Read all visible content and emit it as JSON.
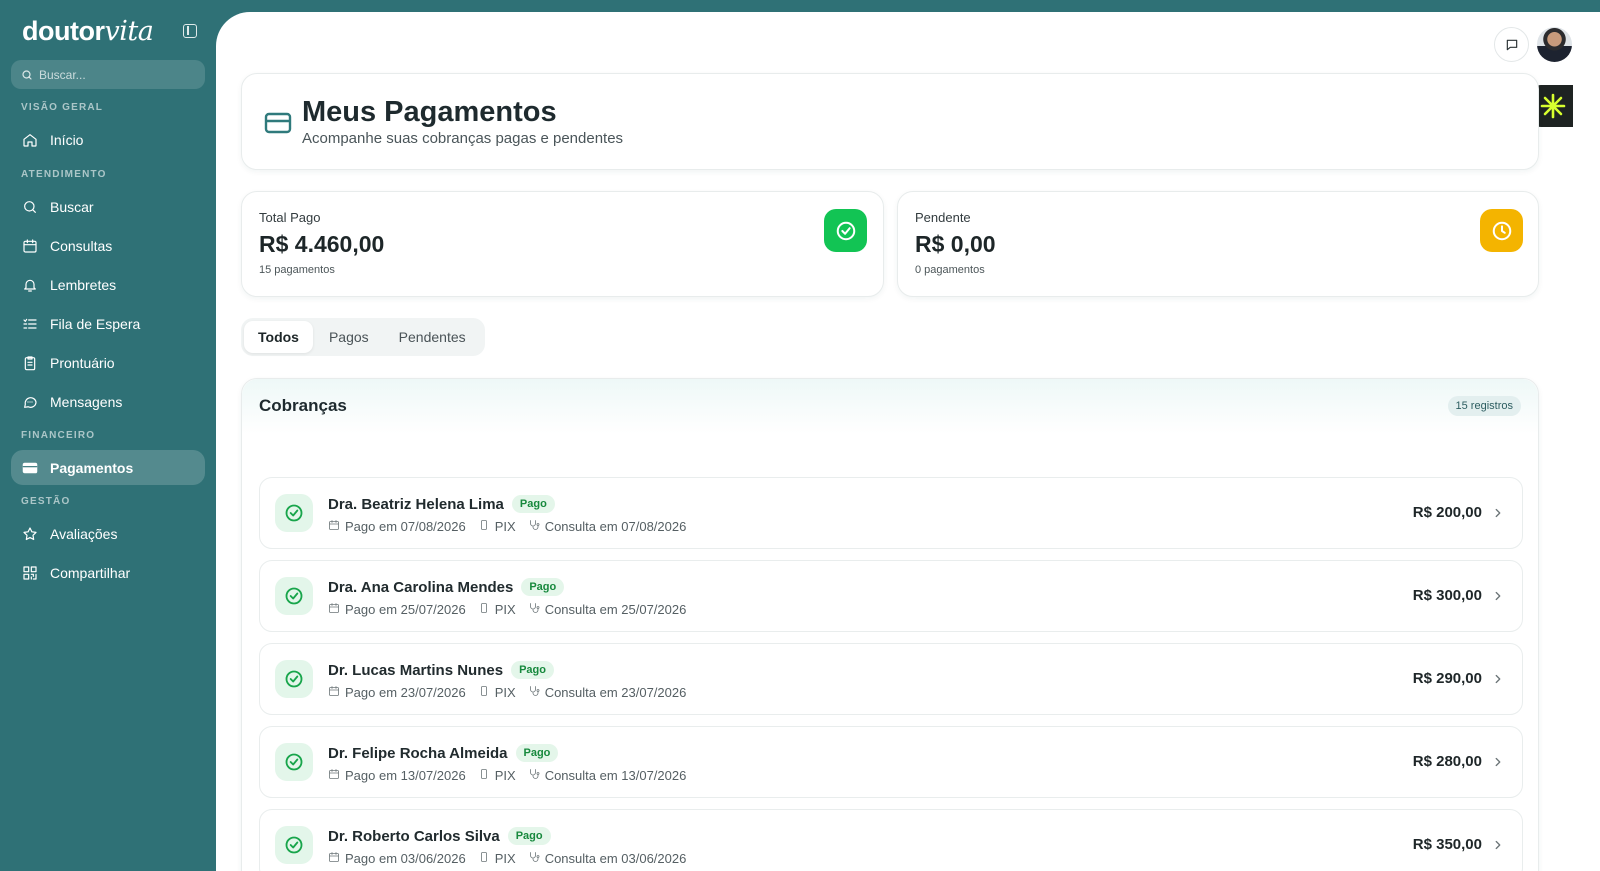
{
  "sidebar": {
    "logo_main": "doutor",
    "logo_accent": "vita",
    "search_placeholder": "Buscar...",
    "sections": {
      "overview": "VISÃO GERAL",
      "service": "ATENDIMENTO",
      "financial": "FINANCEIRO",
      "management": "GESTÃO"
    },
    "items": [
      {
        "label": "Início",
        "icon": "home-icon"
      },
      {
        "label": "Buscar",
        "icon": "search-icon"
      },
      {
        "label": "Consultas",
        "icon": "calendar-icon"
      },
      {
        "label": "Lembretes",
        "icon": "bell-icon"
      },
      {
        "label": "Fila de Espera",
        "icon": "list-check-icon"
      },
      {
        "label": "Prontuário",
        "icon": "clipboard-icon"
      },
      {
        "label": "Mensagens",
        "icon": "message-icon"
      },
      {
        "label": "Pagamentos",
        "icon": "credit-card-icon",
        "active": true
      },
      {
        "label": "Avaliações",
        "icon": "star-icon"
      },
      {
        "label": "Compartilhar",
        "icon": "qr-code-icon"
      }
    ]
  },
  "header": {
    "title": "Meus Pagamentos",
    "subtitle": "Acompanhe suas cobranças pagas e pendentes"
  },
  "stats": {
    "paid": {
      "label": "Total Pago",
      "value": "R$ 4.460,00",
      "count": "15 pagamentos",
      "color": "#12c454"
    },
    "pending": {
      "label": "Pendente",
      "value": "R$ 0,00",
      "count": "0 pagamentos",
      "color": "#f4b400"
    }
  },
  "tabs": [
    "Todos",
    "Pagos",
    "Pendentes"
  ],
  "active_tab": "Todos",
  "list": {
    "title": "Cobranças",
    "records": "15 registros",
    "rows": [
      {
        "name": "Dra. Beatriz Helena Lima",
        "status": "Pago",
        "paid": "Pago em 07/08/2026",
        "method": "PIX",
        "consult": "Consulta em 07/08/2026",
        "amount": "R$ 200,00"
      },
      {
        "name": "Dra. Ana Carolina Mendes",
        "status": "Pago",
        "paid": "Pago em 25/07/2026",
        "method": "PIX",
        "consult": "Consulta em 25/07/2026",
        "amount": "R$ 300,00"
      },
      {
        "name": "Dr. Lucas Martins Nunes",
        "status": "Pago",
        "paid": "Pago em 23/07/2026",
        "method": "PIX",
        "consult": "Consulta em 23/07/2026",
        "amount": "R$ 290,00"
      },
      {
        "name": "Dr. Felipe Rocha Almeida",
        "status": "Pago",
        "paid": "Pago em 13/07/2026",
        "method": "PIX",
        "consult": "Consulta em 13/07/2026",
        "amount": "R$ 280,00"
      },
      {
        "name": "Dr. Roberto Carlos Silva",
        "status": "Pago",
        "paid": "Pago em 03/06/2026",
        "method": "PIX",
        "consult": "Consulta em 03/06/2026",
        "amount": "R$ 350,00"
      }
    ]
  },
  "colors": {
    "sidebar": "#2f7176",
    "accent": "#2f7176",
    "success": "#12c454",
    "warning": "#f4b400"
  }
}
